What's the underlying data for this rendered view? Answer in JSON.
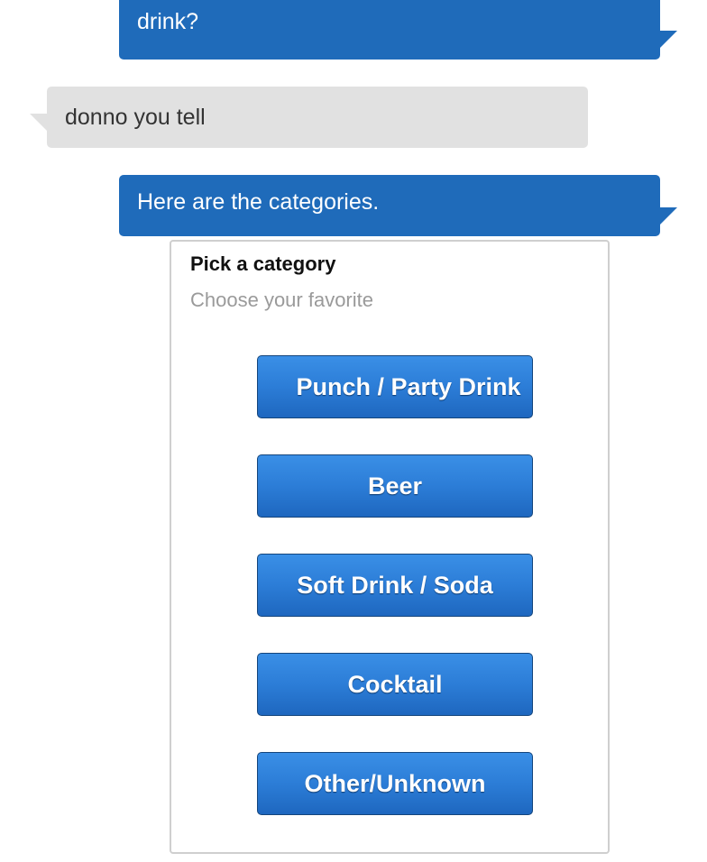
{
  "messages": [
    {
      "sender": "bot",
      "text": "drink?"
    },
    {
      "sender": "user",
      "text": "donno you tell"
    },
    {
      "sender": "bot",
      "text": "Here are the categories."
    }
  ],
  "card": {
    "title": "Pick a category",
    "subtitle": "Choose your favorite",
    "options": [
      {
        "label": "Punch / Party Drink"
      },
      {
        "label": "Beer"
      },
      {
        "label": "Soft Drink / Soda"
      },
      {
        "label": "Cocktail"
      },
      {
        "label": "Other/Unknown"
      }
    ]
  },
  "colors": {
    "bot_bubble": "#1f6bba",
    "user_bubble": "#e1e1e1",
    "button": "#2c7dd7"
  }
}
